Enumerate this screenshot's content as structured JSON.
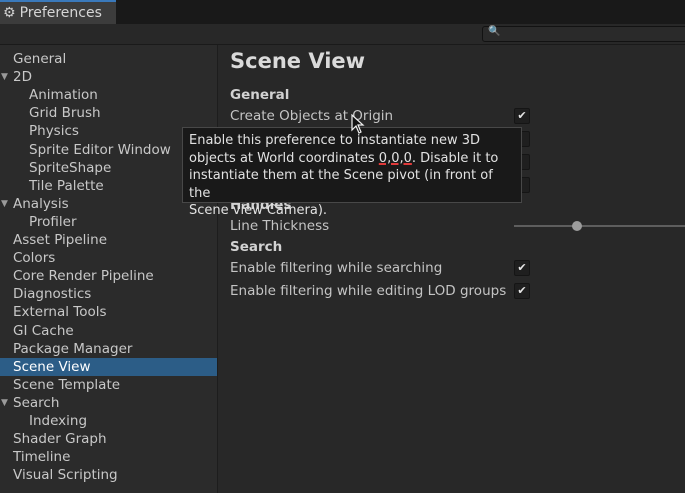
{
  "window": {
    "tab_title": "Preferences",
    "tab_icon": "gear-icon"
  },
  "search": {
    "placeholder": ""
  },
  "sidebar": {
    "items": [
      {
        "label": "General",
        "indent": 0,
        "arrow": false,
        "selected": false
      },
      {
        "label": "2D",
        "indent": 0,
        "arrow": true,
        "selected": false
      },
      {
        "label": "Animation",
        "indent": 1,
        "arrow": false,
        "selected": false
      },
      {
        "label": "Grid Brush",
        "indent": 1,
        "arrow": false,
        "selected": false
      },
      {
        "label": "Physics",
        "indent": 1,
        "arrow": false,
        "selected": false
      },
      {
        "label": "Sprite Editor Window",
        "indent": 1,
        "arrow": false,
        "selected": false
      },
      {
        "label": "SpriteShape",
        "indent": 1,
        "arrow": false,
        "selected": false
      },
      {
        "label": "Tile Palette",
        "indent": 1,
        "arrow": false,
        "selected": false
      },
      {
        "label": "Analysis",
        "indent": 0,
        "arrow": true,
        "selected": false
      },
      {
        "label": "Profiler",
        "indent": 1,
        "arrow": false,
        "selected": false
      },
      {
        "label": "Asset Pipeline",
        "indent": 0,
        "arrow": false,
        "selected": false
      },
      {
        "label": "Colors",
        "indent": 0,
        "arrow": false,
        "selected": false
      },
      {
        "label": "Core Render Pipeline",
        "indent": 0,
        "arrow": false,
        "selected": false
      },
      {
        "label": "Diagnostics",
        "indent": 0,
        "arrow": false,
        "selected": false
      },
      {
        "label": "External Tools",
        "indent": 0,
        "arrow": false,
        "selected": false
      },
      {
        "label": "GI Cache",
        "indent": 0,
        "arrow": false,
        "selected": false
      },
      {
        "label": "Package Manager",
        "indent": 0,
        "arrow": false,
        "selected": false
      },
      {
        "label": "Scene View",
        "indent": 0,
        "arrow": false,
        "selected": true
      },
      {
        "label": "Scene Template",
        "indent": 0,
        "arrow": false,
        "selected": false
      },
      {
        "label": "Search",
        "indent": 0,
        "arrow": true,
        "selected": false
      },
      {
        "label": "Indexing",
        "indent": 1,
        "arrow": false,
        "selected": false
      },
      {
        "label": "Shader Graph",
        "indent": 0,
        "arrow": false,
        "selected": false
      },
      {
        "label": "Timeline",
        "indent": 0,
        "arrow": false,
        "selected": false
      },
      {
        "label": "Visual Scripting",
        "indent": 0,
        "arrow": false,
        "selected": false
      }
    ]
  },
  "main": {
    "title": "Scene View",
    "general": {
      "header": "General",
      "create_objects_label": "Create Objects at Origin",
      "create_objects_checked": true
    },
    "handles": {
      "header": "Handles",
      "line_thickness_label": "Line Thickness",
      "line_thickness_value": 0.37
    },
    "search": {
      "header": "Search",
      "filter_searching_label": "Enable filtering while searching",
      "filter_searching_checked": true,
      "filter_lod_label": "Enable filtering while editing LOD groups",
      "filter_lod_checked": true
    }
  },
  "tooltip": {
    "line1": "Enable this preference to instantiate new 3D",
    "line2_prefix": "objects at World coordinates ",
    "line2_highlight": "0,0,0",
    "line2_suffix": ". Disable it to",
    "line3": "instantiate them at the Scene pivot (in front of the",
    "line4": "Scene view Camera)."
  },
  "colors": {
    "selection": "#2c5d87",
    "tab_accent": "#3a79bb",
    "annotation_underline": "#e03a3a"
  }
}
